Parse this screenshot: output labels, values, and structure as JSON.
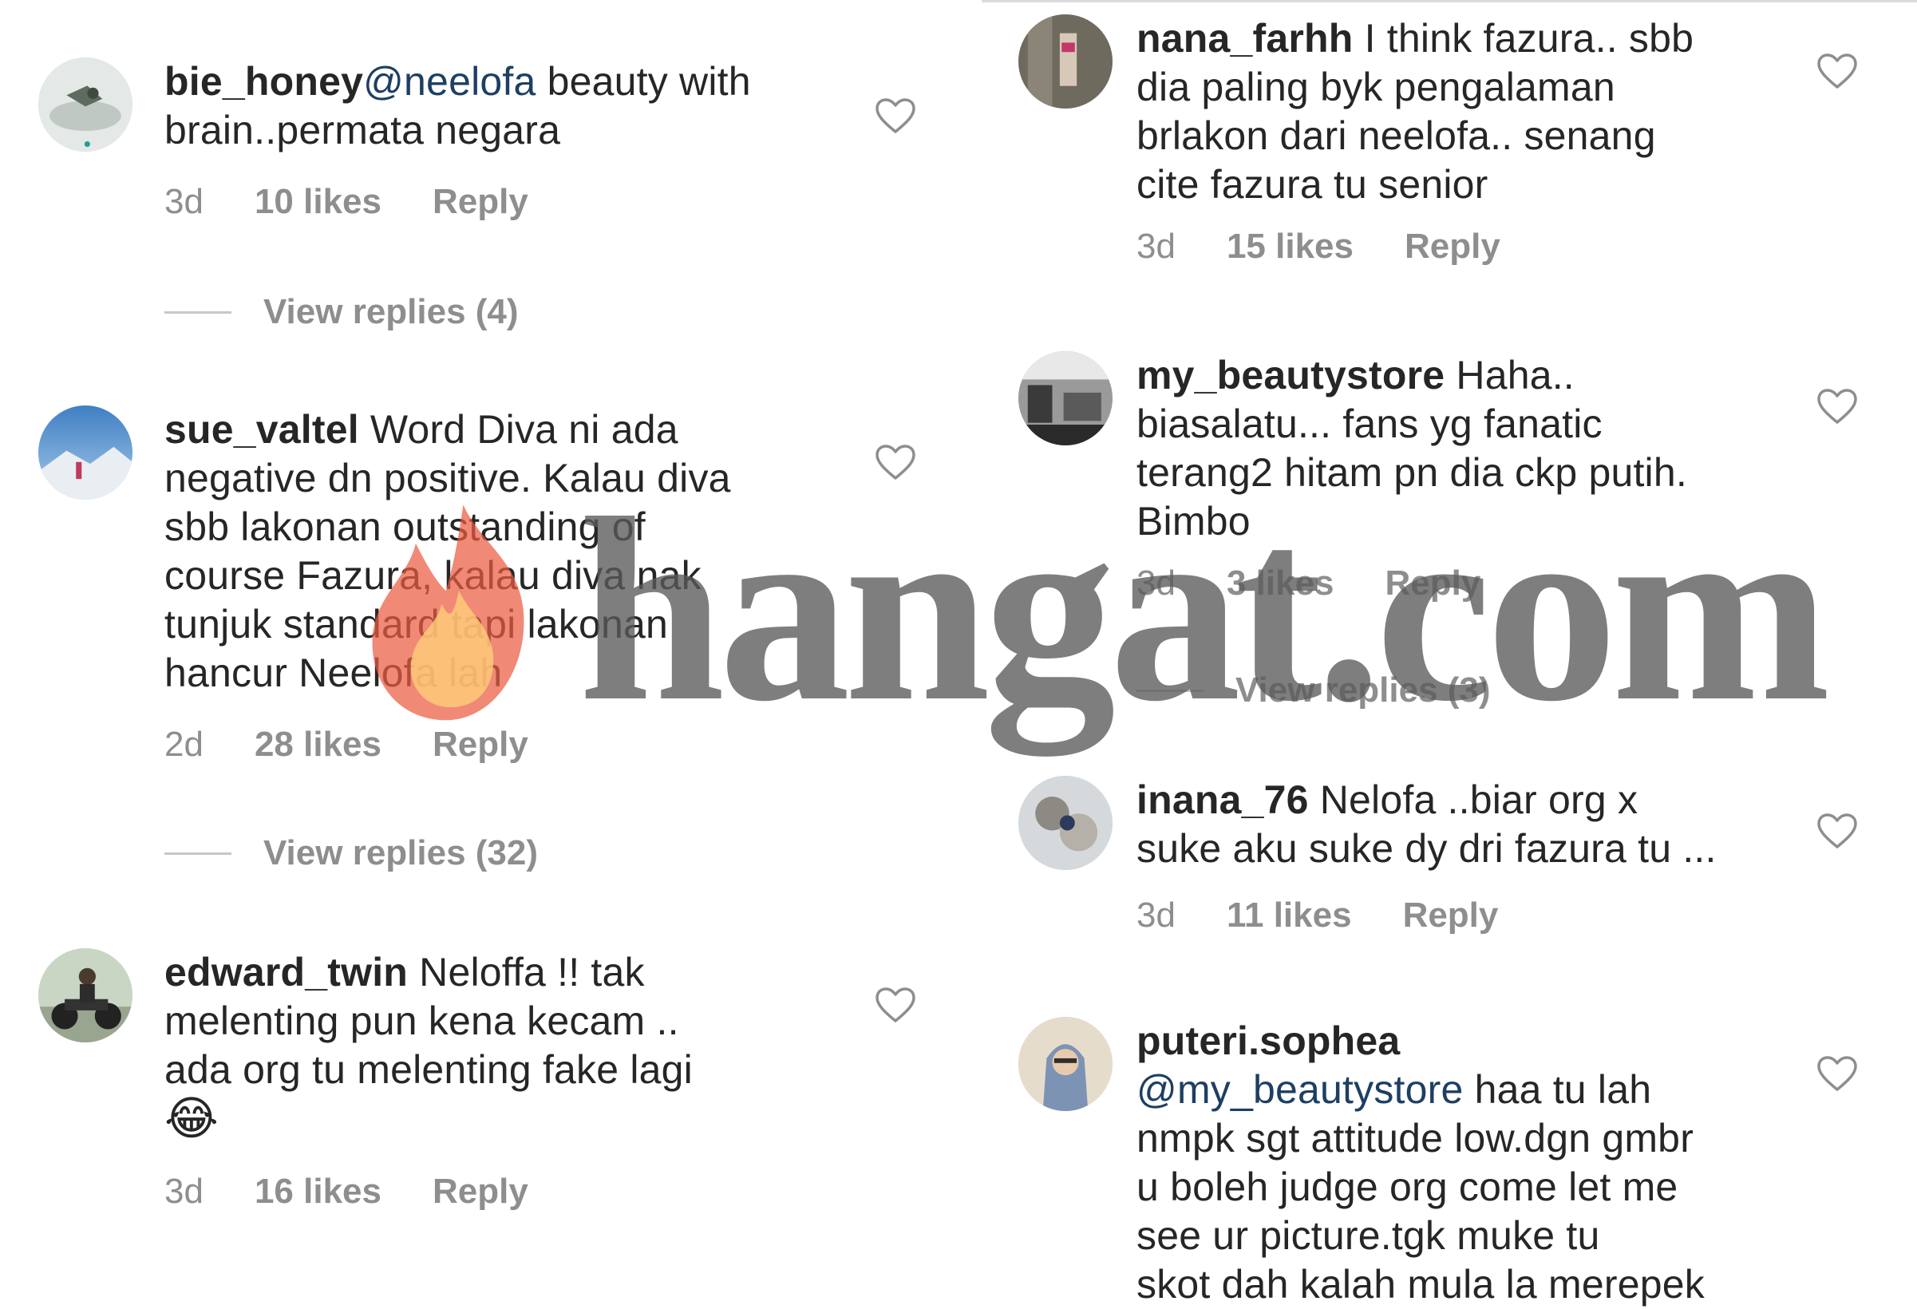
{
  "watermark": {
    "text": "hangat.com"
  },
  "left_comments": [
    {
      "username": "bie_honey",
      "mention": "@neelofa",
      "lines": [
        " beauty with",
        "brain..permata negara"
      ],
      "time": "3d",
      "likes": "10 likes",
      "reply": "Reply",
      "view_replies": "View replies (4)"
    },
    {
      "username": "sue_valtel",
      "lines": [
        " Word Diva ni ada",
        "negative dn positive. Kalau diva",
        "sbb lakonan outstanding of",
        "course Fazura, kalau diva nak",
        "tunjuk standard tapi lakonan",
        "hancur Neelofa lah"
      ],
      "time": "2d",
      "likes": "28 likes",
      "reply": "Reply",
      "view_replies": "View replies (32)"
    },
    {
      "username": "edward_twin",
      "lines": [
        " Neloffa !! tak",
        "melenting pun kena kecam ..",
        "ada org tu melenting fake lagi"
      ],
      "emoji": "😂",
      "time": "3d",
      "likes": "16 likes",
      "reply": "Reply"
    }
  ],
  "right_comments": [
    {
      "username": "nana_farhh",
      "lines": [
        " I think fazura.. sbb",
        "dia paling byk pengalaman",
        "brlakon dari neelofa.. senang",
        "cite fazura tu senior"
      ],
      "time": "3d",
      "likes": "15 likes",
      "reply": "Reply"
    },
    {
      "username": "my_beautystore",
      "lines": [
        " Haha..",
        "biasalatu... fans yg fanatic",
        "terang2 hitam pn dia ckp putih.",
        "Bimbo"
      ],
      "time": "3d",
      "likes": "3 likes",
      "reply": "Reply",
      "view_replies": "View replies (3)"
    },
    {
      "username": "inana_76",
      "lines": [
        " Nelofa ..biar org x",
        "suke aku suke dy dri fazura tu ..."
      ],
      "time": "3d",
      "likes": "11 likes",
      "reply": "Reply"
    },
    {
      "username": "puteri.sophea",
      "mention": "@my_beautystore",
      "lines": [
        " haa tu lah",
        "nmpk sgt attitude low.dgn gmbr",
        "u boleh judge org come let me",
        "see ur picture.tgk muke tu",
        "skot dah kalah mula la merepek"
      ]
    }
  ],
  "colors": {
    "text": "#262626",
    "meta": "#8e8e8e",
    "mention": "#1d3f63",
    "divider": "#dbdbdb"
  },
  "icons": {
    "like": "heart-outline-icon"
  }
}
